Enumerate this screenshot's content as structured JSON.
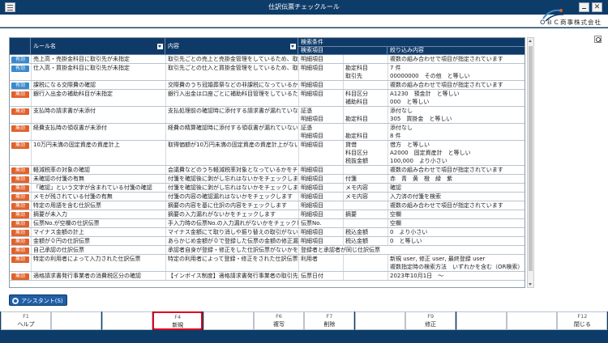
{
  "window": {
    "title": "仕訳伝票チェックルール",
    "company": "ＯＢＣ商事株式会社"
  },
  "grid": {
    "headers": {
      "rule_name": "ルール名",
      "content": "内容",
      "search_conditions": "検索条件",
      "search_item": "検索項目",
      "filter_content": "絞り込み内容"
    },
    "rows": [
      {
        "badge": "有効",
        "status": "valid",
        "lines": [
          {
            "name": "売上高・売掛金科目に取引先が未指定",
            "content": "取引先ごとの売上と売掛金管理をしているため、取引",
            "item": "明細項目",
            "sub": "",
            "cond": "複数の組み合わせで項目が指定されています"
          }
        ]
      },
      {
        "badge": "有効",
        "status": "valid",
        "lines": [
          {
            "name": "仕入高・買掛金科目に取引先が未指定",
            "content": "取引先ごとの仕入と買掛金管理をしているため、取引",
            "item": "明細項目",
            "sub": "勘定科目",
            "cond": "7 件"
          },
          {
            "name": "",
            "content": "",
            "item": "",
            "sub": "取引先",
            "cond": "00000000　その他　と等しい"
          }
        ]
      },
      {
        "badge": "有効",
        "status": "valid",
        "lines": [
          {
            "name": "課税になる交際費の確認",
            "content": "交際費のうち冠婚葬祭などの非課税になっているかを",
            "item": "明細項目",
            "sub": "",
            "cond": "複数の組み合わせで項目が指定されています"
          }
        ]
      },
      {
        "badge": "無効",
        "status": "invalid",
        "lines": [
          {
            "name": "銀行入出金の補助科目が未指定",
            "content": "銀行入出金は口座ごとに補助科目管理をしているため",
            "item": "明細項目",
            "sub": "科目区分",
            "cond": "A1230　預金計　と等しい"
          },
          {
            "name": "",
            "content": "",
            "item": "",
            "sub": "補助科目",
            "cond": "000　と等しい"
          }
        ]
      },
      {
        "badge": "無効",
        "status": "invalid",
        "lines": [
          {
            "name": "支払時の請求書が未添付",
            "content": "支払処理前の確認時に添付する請求書が漏れていない",
            "item": "証憑",
            "sub": "",
            "cond": "添付なし"
          },
          {
            "name": "",
            "content": "",
            "item": "明細項目",
            "sub": "勘定科目",
            "cond": "305　買掛金　と等しい"
          }
        ]
      },
      {
        "badge": "無効",
        "status": "invalid",
        "lines": [
          {
            "name": "経費支払時の領収書が未添付",
            "content": "経費の精算確認時に添付する領収書が漏れていないか",
            "item": "証憑",
            "sub": "",
            "cond": "添付なし"
          },
          {
            "name": "",
            "content": "",
            "item": "明細項目",
            "sub": "勘定科目",
            "cond": "8 件"
          }
        ]
      },
      {
        "badge": "無効",
        "status": "invalid",
        "lines": [
          {
            "name": "10万円未満の固定資産の資産計上",
            "content": "取得価額が10万円未満の固定資産の資産計上がないか",
            "item": "明細項目",
            "sub": "貸借",
            "cond": "借方　と等しい"
          },
          {
            "name": "",
            "content": "",
            "item": "",
            "sub": "科目区分",
            "cond": "A2000　固定資産計　と等しい"
          },
          {
            "name": "",
            "content": "",
            "item": "",
            "sub": "税抜金額",
            "cond": "100,000　より小さい"
          }
        ]
      },
      {
        "badge": "無効",
        "status": "invalid",
        "lines": [
          {
            "name": "軽減税率の対象の確認",
            "content": "会議費などのうち軽減税率対象となっているかをチェ",
            "item": "明細項目",
            "sub": "",
            "cond": "複数の組み合わせで項目が指定されています"
          }
        ]
      },
      {
        "badge": "無効",
        "status": "invalid",
        "lines": [
          {
            "name": "未確認の付箋の有無",
            "content": "付箋を確認後に剥がし忘れはないかをチェックします",
            "item": "明細項目",
            "sub": "付箋",
            "cond": "赤　青　黄　橙　緑　紫"
          }
        ]
      },
      {
        "badge": "無効",
        "status": "invalid",
        "lines": [
          {
            "name": "「確認」という文字が含まれている付箋の確認",
            "content": "付箋を確認後に剥がし忘れはないかをチェックします",
            "item": "明細項目",
            "sub": "メモ内容",
            "cond": "確認"
          }
        ]
      },
      {
        "badge": "無効",
        "status": "invalid",
        "lines": [
          {
            "name": "メモが残されている付箋の有無",
            "content": "付箋の内容の確認漏れはないかをチェックします",
            "item": "明細項目",
            "sub": "メモ内容",
            "cond": "入力済の付箋を検索"
          }
        ]
      },
      {
        "badge": "無効",
        "status": "invalid",
        "lines": [
          {
            "name": "特定の用語を含む仕訳伝票",
            "content": "摘要の内容を基に仕訳の内容をチェックします",
            "item": "明細項目",
            "sub": "",
            "cond": "複数の組み合わせで項目が指定されています"
          }
        ]
      },
      {
        "badge": "無効",
        "status": "invalid",
        "lines": [
          {
            "name": "摘要が未入力",
            "content": "摘要の入力漏れがないかをチェックします",
            "item": "明細項目",
            "sub": "摘要",
            "cond": "空欄"
          }
        ]
      },
      {
        "badge": "無効",
        "status": "invalid",
        "lines": [
          {
            "name": "伝票No.が空欄の仕訳伝票",
            "content": "手入力時の伝票No.の入力漏れがないかをチェックし",
            "item": "伝票No.",
            "sub": "",
            "cond": "空欄"
          }
        ]
      },
      {
        "badge": "無効",
        "status": "invalid",
        "lines": [
          {
            "name": "マイナス金額の計上",
            "content": "マイナス金額にて取り消しや振り替えの取引がないか",
            "item": "明細項目",
            "sub": "税込金額",
            "cond": "0　より小さい"
          }
        ]
      },
      {
        "badge": "無効",
        "status": "invalid",
        "lines": [
          {
            "name": "金額が０円の仕訳伝票",
            "content": "あらかじめ金額が０で登録した伝票の金額の修正漏れ",
            "item": "明細項目",
            "sub": "税込金額",
            "cond": "0　と等しい"
          }
        ]
      },
      {
        "badge": "無効",
        "status": "invalid",
        "lines": [
          {
            "name": "自己承認の仕訳伝票",
            "content": "承認者自身が登録・修正をした仕訳伝票がないかをチ",
            "item": "登録者と承認者が同じ仕訳伝票",
            "sub": "",
            "cond": ""
          }
        ]
      },
      {
        "badge": "無効",
        "status": "invalid",
        "lines": [
          {
            "name": "特定の利用者によって入力された仕訳伝票",
            "content": "特定の利用者によって登録・修正をされた仕訳伝票が",
            "item": "利用者",
            "sub": "",
            "cond": "新規 user, 修正 user, 最終登録 user"
          },
          {
            "name": "",
            "content": "",
            "item": "",
            "sub": "",
            "cond": "複数指定時の検索方法　いずれかを含む（OR検索）"
          }
        ]
      },
      {
        "badge": "無効",
        "status": "invalid",
        "lines": [
          {
            "name": "適格請求書発行事業者の消費税区分の確認",
            "content": "【インボイス制度】適格請求書発行事業者の取引先に",
            "item": "伝票日付",
            "sub": "",
            "cond": "2023年10月1日　〜"
          }
        ]
      }
    ]
  },
  "assistant_label": "アシスタント(S)",
  "fkeys": [
    {
      "key": "F1",
      "label": "ヘルプ",
      "enabled": true
    },
    {
      "key": "",
      "label": "",
      "enabled": false
    },
    {
      "key": "",
      "label": "",
      "enabled": false
    },
    {
      "key": "F4",
      "label": "新規",
      "enabled": true,
      "highlight": true
    },
    {
      "key": "",
      "label": "",
      "enabled": false
    },
    {
      "key": "F6",
      "label": "複写",
      "enabled": true
    },
    {
      "key": "F7",
      "label": "削除",
      "enabled": true
    },
    {
      "key": "",
      "label": "",
      "enabled": false
    },
    {
      "key": "F9",
      "label": "修正",
      "enabled": true
    },
    {
      "key": "",
      "label": "",
      "enabled": false
    },
    {
      "key": "",
      "label": "",
      "enabled": false
    },
    {
      "key": "F12",
      "label": "閉じる",
      "enabled": true
    }
  ]
}
